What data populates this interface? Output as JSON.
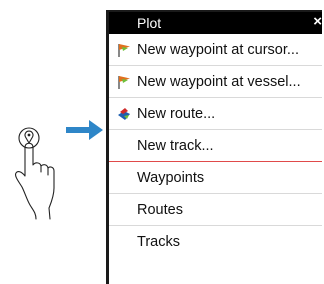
{
  "menu": {
    "title": "Plot",
    "close_icon": "×",
    "items": [
      {
        "label": "New waypoint at cursor...",
        "icon": "waypoint-flag-icon"
      },
      {
        "label": "New waypoint at vessel...",
        "icon": "waypoint-flag-icon"
      },
      {
        "label": "New route...",
        "icon": "route-icon"
      },
      {
        "label": "New track...",
        "icon": ""
      },
      {
        "label": "Waypoints",
        "icon": ""
      },
      {
        "label": "Routes",
        "icon": ""
      },
      {
        "label": "Tracks",
        "icon": ""
      }
    ]
  },
  "colors": {
    "header_bg": "#000000",
    "arrow": "#2e86c8",
    "separator": "#e04a4a",
    "flag_orange": "#e0701f",
    "flag_green": "#6fbf3a",
    "route_blue": "#1f5fb0",
    "route_red": "#d02a2a"
  }
}
